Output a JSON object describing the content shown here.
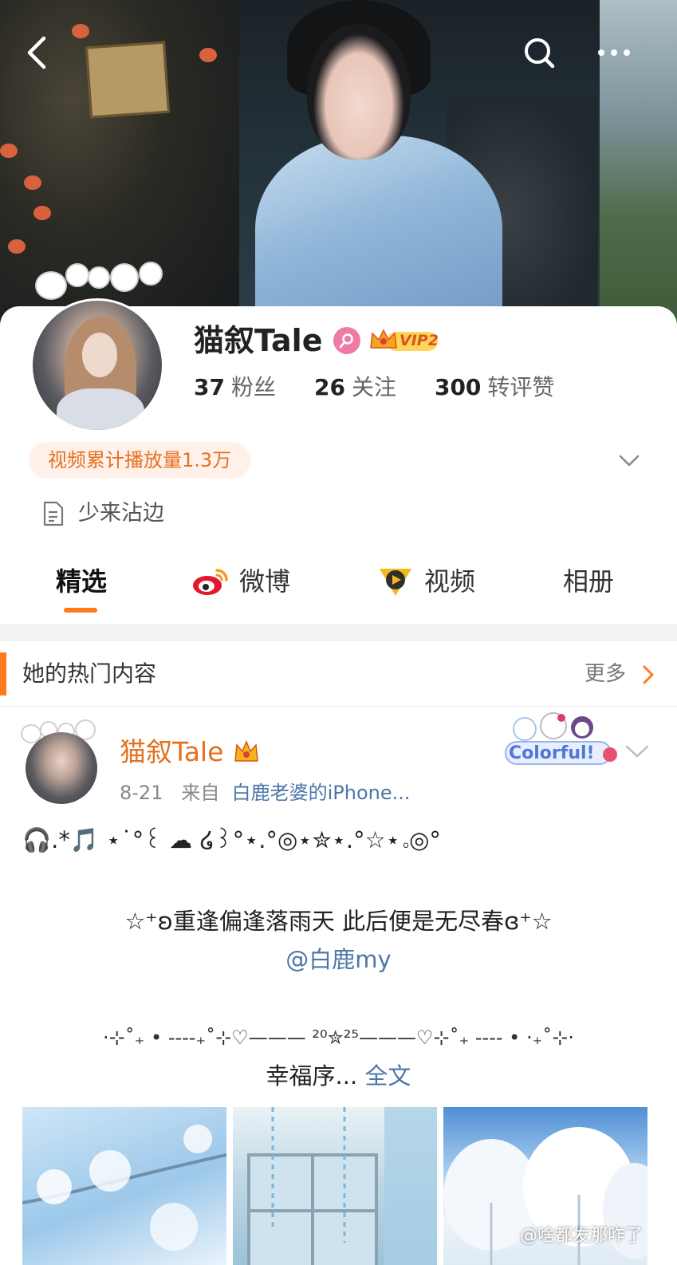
{
  "profile": {
    "name": "猫叙Tale",
    "vip_label": "VIP2",
    "stats": [
      {
        "value": "37",
        "label": "粉丝"
      },
      {
        "value": "26",
        "label": "关注"
      },
      {
        "value": "300",
        "label": "转评赞"
      }
    ],
    "plays_badge": "视频累计播放量1.3万",
    "bio": "少来沾边"
  },
  "tabs": [
    {
      "label": "精选",
      "active": true
    },
    {
      "label": "微博",
      "icon": "weibo-logo-icon"
    },
    {
      "label": "视频",
      "icon": "video-badge-icon"
    },
    {
      "label": "相册"
    }
  ],
  "section": {
    "title": "她的热门内容",
    "more": "更多"
  },
  "post": {
    "author": "猫叙Tale",
    "date": "8-21",
    "from_prefix": "来自",
    "source": "白鹿老婆的iPhone...",
    "badge_text": "Colorful!",
    "line1": "🎧.*🎵 ⋆˙°꒰ ☁ ໒꒱°⋆.°◎⋆✮⋆.°☆⋆｡◎°",
    "line2": "☆⁺ʚ重逢偏逢落雨天  此后便是无尽春ɞ⁺☆",
    "mention": "@白鹿my",
    "line3": "·⊹˚₊ • ----₊˚⊹♡——— ²⁰✮²⁵———♡⊹˚₊ ---- • ·₊˚⊹·",
    "line4_text": "幸福序...",
    "full_text": "全文"
  },
  "watermark": "@啥都发那咋了",
  "colors": {
    "accent": "#ff7a1c",
    "orange_text": "#e5701e",
    "link": "#4d76a8",
    "gender": "#f07aa6"
  }
}
